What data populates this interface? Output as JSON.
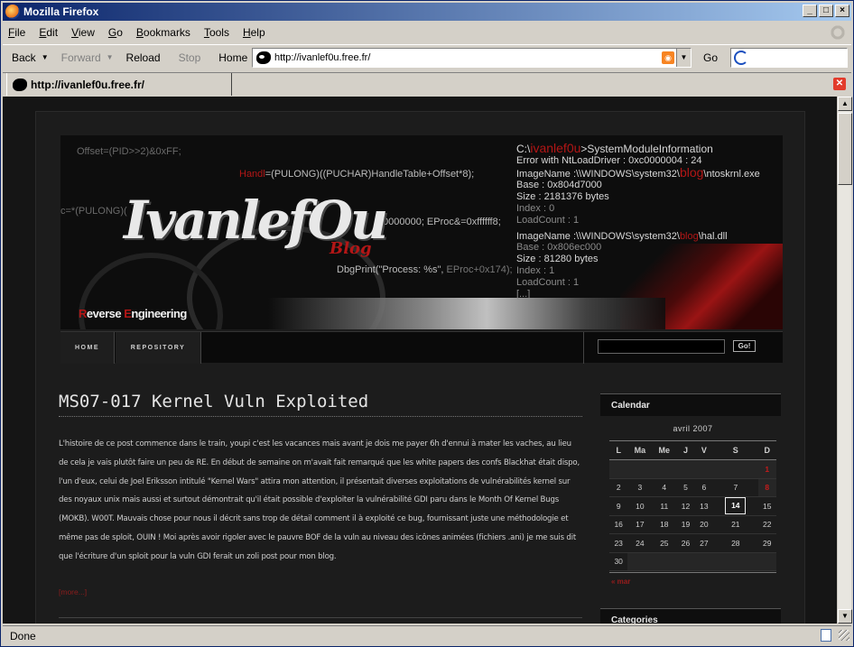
{
  "window": {
    "title": "Mozilla Firefox"
  },
  "menu": [
    "File",
    "Edit",
    "View",
    "Go",
    "Bookmarks",
    "Tools",
    "Help"
  ],
  "nav": {
    "back": "Back",
    "forward": "Forward",
    "reload": "Reload",
    "stop": "Stop",
    "home": "Home",
    "go": "Go"
  },
  "address": {
    "url": "http://ivanlef0u.free.fr/"
  },
  "tab": {
    "title": "http://ivanlef0u.free.fr/"
  },
  "status": {
    "text": "Done"
  },
  "banner": {
    "code1": "Offset=(PID>>2)&0xFF;",
    "code2a": "Handl",
    "code2b": "=(PULONG)((PUCHAR)HandleTable+Offset*8);",
    "code3": "c=*(PULONG)(",
    "code4": "0000000; EProc&=0xffffff8;",
    "code5a": "DbgPrint(\"Process: %s\", ",
    "code5b": "EProc+0x174);",
    "logo_main": "IvanlefOu",
    "logo_blog": "Blog",
    "tagline_r": "R",
    "tagline_everse": "everse ",
    "tagline_e": "E",
    "tagline_ngineering": "ngineering",
    "sys_prompt_c": "C:\\",
    "sys_prompt_name": "ivanlef0u",
    "sys_prompt_cmd": ">SystemModuleInformation",
    "sys_lines": [
      " Error with NtLoadDriver : 0xc0000004 : 24",
      "ImageName :\\\\WINDOWS\\system32\\",
      "Base : 0x804d7000",
      "Size : 2181376 bytes",
      "Index : 0",
      "LoadCount : 1",
      "ImageName :\\\\WINDOWS\\system32\\",
      "Base : 0x806ec000",
      "Size : 81280 bytes",
      "Index : 1",
      "LoadCount : 1",
      "[...]"
    ],
    "blog_word": "blog",
    "file1": "\\ntoskrnl.exe",
    "file2": "\\hal.dll"
  },
  "sitenav": {
    "home": "HOME",
    "repository": "REPOSITORY",
    "search_button": "Go!"
  },
  "post": {
    "title": "MS07-017 Kernel Vuln Exploited",
    "body": "L'histoire de ce post commence dans le train, youpi c'est les vacances mais avant je dois me payer 6h d'ennui à mater les vaches, au lieu de cela je vais plutôt faire un peu de RE. En début de semaine on m'avait fait remarqué que les white papers des confs Blackhat était dispo, l'un d'eux, celui de Joel Eriksson intitulé \"Kernel Wars\" attira mon attention, il présentait diverses exploitations de vulnérabilités kernel sur des noyaux unix mais aussi et surtout démontrait qu'il était possible d'exploiter la vulnérabilité GDI paru dans le Month Of Kernel Bugs (MOKB). W00T. Mauvais chose pour nous il décrit sans trop de détail comment il à exploité ce bug, fournissant juste une méthodologie et même pas de sploit, OUIN ! Moi après avoir rigoler avec le pauvre BOF de la vuln au niveau des icônes animées (fichiers .ani) je me suis dit que l'écriture d'un sploit pour la vuln GDI ferait un zoli post pour mon blog.",
    "more": "[more...]"
  },
  "sidebar": {
    "calendar_title": "Calendar",
    "month": "avril 2007",
    "weekdays": [
      "L",
      "Ma",
      "Me",
      "J",
      "V",
      "S",
      "D"
    ],
    "weeks": [
      [
        "",
        "",
        "",
        "",
        "",
        "",
        "1"
      ],
      [
        "2",
        "3",
        "4",
        "5",
        "6",
        "7",
        "8"
      ],
      [
        "9",
        "10",
        "11",
        "12",
        "13",
        "14",
        "15"
      ],
      [
        "16",
        "17",
        "18",
        "19",
        "20",
        "21",
        "22"
      ],
      [
        "23",
        "24",
        "25",
        "26",
        "27",
        "28",
        "29"
      ],
      [
        "30",
        "",
        "",
        "",
        "",
        "",
        ""
      ]
    ],
    "today": "14",
    "prev": "« mar",
    "categories_title": "Categories"
  }
}
